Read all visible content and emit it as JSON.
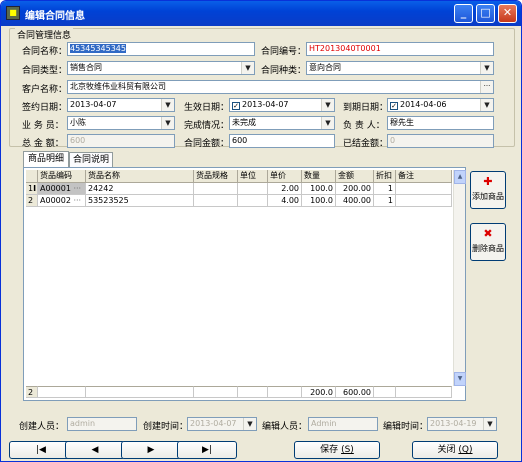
{
  "window": {
    "title": "编辑合同信息",
    "icon_text": "■",
    "minimize": "_",
    "maximize": "□",
    "close": "✕"
  },
  "group_title": "合同管理信息",
  "form": {
    "contract_name": {
      "label": "合同名称：",
      "value": "45345345345"
    },
    "contract_no": {
      "label": "合同编号：",
      "value": "HT2013040T0001"
    },
    "contract_type": {
      "label": "合同类型：",
      "value": "销售合同"
    },
    "contract_kind": {
      "label": "合同种类：",
      "value": "意向合同"
    },
    "customer": {
      "label": "客户名称：",
      "value": "北京牧维伟业科贸有限公司"
    },
    "sign_date": {
      "label": "签约日期：",
      "value": "2013-04-07"
    },
    "effective_date": {
      "label": "生效日期：",
      "value": "2013-04-07"
    },
    "expire_date": {
      "label": "到期日期：",
      "value": "2014-04-06"
    },
    "salesman": {
      "label": "业 务 员：",
      "value": "小陈"
    },
    "completion": {
      "label": "完成情况：",
      "value": "未完成"
    },
    "owner": {
      "label": "负 责 人：",
      "value": "穆先生"
    },
    "total_amount": {
      "label": "总 金 额：",
      "value": "600"
    },
    "contract_amount": {
      "label": "合同金额：",
      "value": "600"
    },
    "settled_amount": {
      "label": "已结金额：",
      "value": "0"
    }
  },
  "tabs": [
    "商品明细",
    "合同说明"
  ],
  "grid": {
    "columns": [
      "货品编码",
      "货品名称",
      "货品规格",
      "单位",
      "单价",
      "数量",
      "金额",
      "折扣",
      "备注"
    ],
    "rows": [
      {
        "no": "1",
        "code": "A00001",
        "name": "24242",
        "spec": "",
        "unit": "",
        "price": "2.00",
        "qty": "100.0",
        "amount": "200.00",
        "discount": "1",
        "note": ""
      },
      {
        "no": "2",
        "code": "A00002",
        "name": "53523525",
        "spec": "",
        "unit": "",
        "price": "4.00",
        "qty": "100.0",
        "amount": "400.00",
        "discount": "1",
        "note": ""
      }
    ],
    "total": {
      "count": "2",
      "qty": "200.0",
      "amount": "600.00"
    },
    "row_marker": "I",
    "cell_button": "···"
  },
  "side_buttons": {
    "add": {
      "icon": "✚",
      "label": "添加商品"
    },
    "remove": {
      "icon": "✖",
      "label": "删除商品"
    }
  },
  "footer": {
    "creator": {
      "label": "创建人员：",
      "value": "admin"
    },
    "create_time": {
      "label": "创建时间：",
      "value": "2013-04-07"
    },
    "editor": {
      "label": "编辑人员：",
      "value": "Admin"
    },
    "edit_time": {
      "label": "编辑时间：",
      "value": "2013-04-19"
    }
  },
  "nav": {
    "first": "|◀",
    "prev": "◀",
    "next": "▶",
    "last": "▶|"
  },
  "actions": {
    "save": "保存",
    "save_key": "(S)",
    "close": "关闭",
    "close_key": "(Q)"
  },
  "glyphs": {
    "arrow": "▼",
    "dots": "···",
    "check": "✓"
  }
}
